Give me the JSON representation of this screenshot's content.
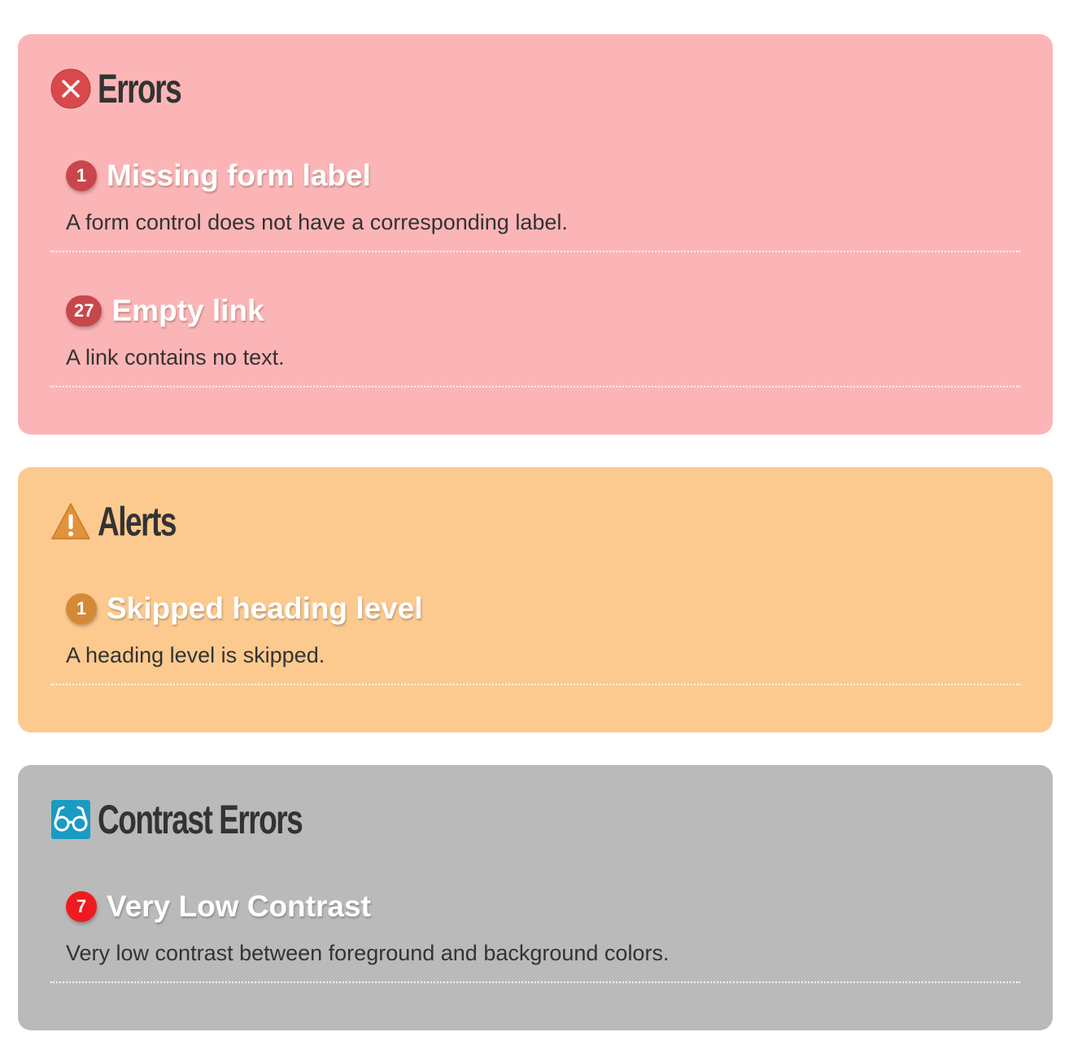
{
  "colors": {
    "errors_bg": "#fcb5b6",
    "alerts_bg": "#fcca8f",
    "contrast_bg": "#bababa",
    "error_badge": "#c8474c",
    "alert_badge": "#d48936",
    "contrast_badge": "#ee1a1f",
    "title_text": "#333333",
    "item_title_text": "#ffffff"
  },
  "sections": {
    "errors": {
      "icon": "error-x-icon",
      "title": "Errors",
      "items": [
        {
          "count": "1",
          "title": "Missing form label",
          "description": "A form control does not have a corresponding label."
        },
        {
          "count": "27",
          "title": "Empty link",
          "description": "A link contains no text."
        }
      ]
    },
    "alerts": {
      "icon": "warning-triangle-icon",
      "title": "Alerts",
      "items": [
        {
          "count": "1",
          "title": "Skipped heading level",
          "description": "A heading level is skipped."
        }
      ]
    },
    "contrast": {
      "icon": "glasses-icon",
      "title": "Contrast Errors",
      "items": [
        {
          "count": "7",
          "title": "Very Low Contrast",
          "description": "Very low contrast between foreground and background colors."
        }
      ]
    }
  }
}
